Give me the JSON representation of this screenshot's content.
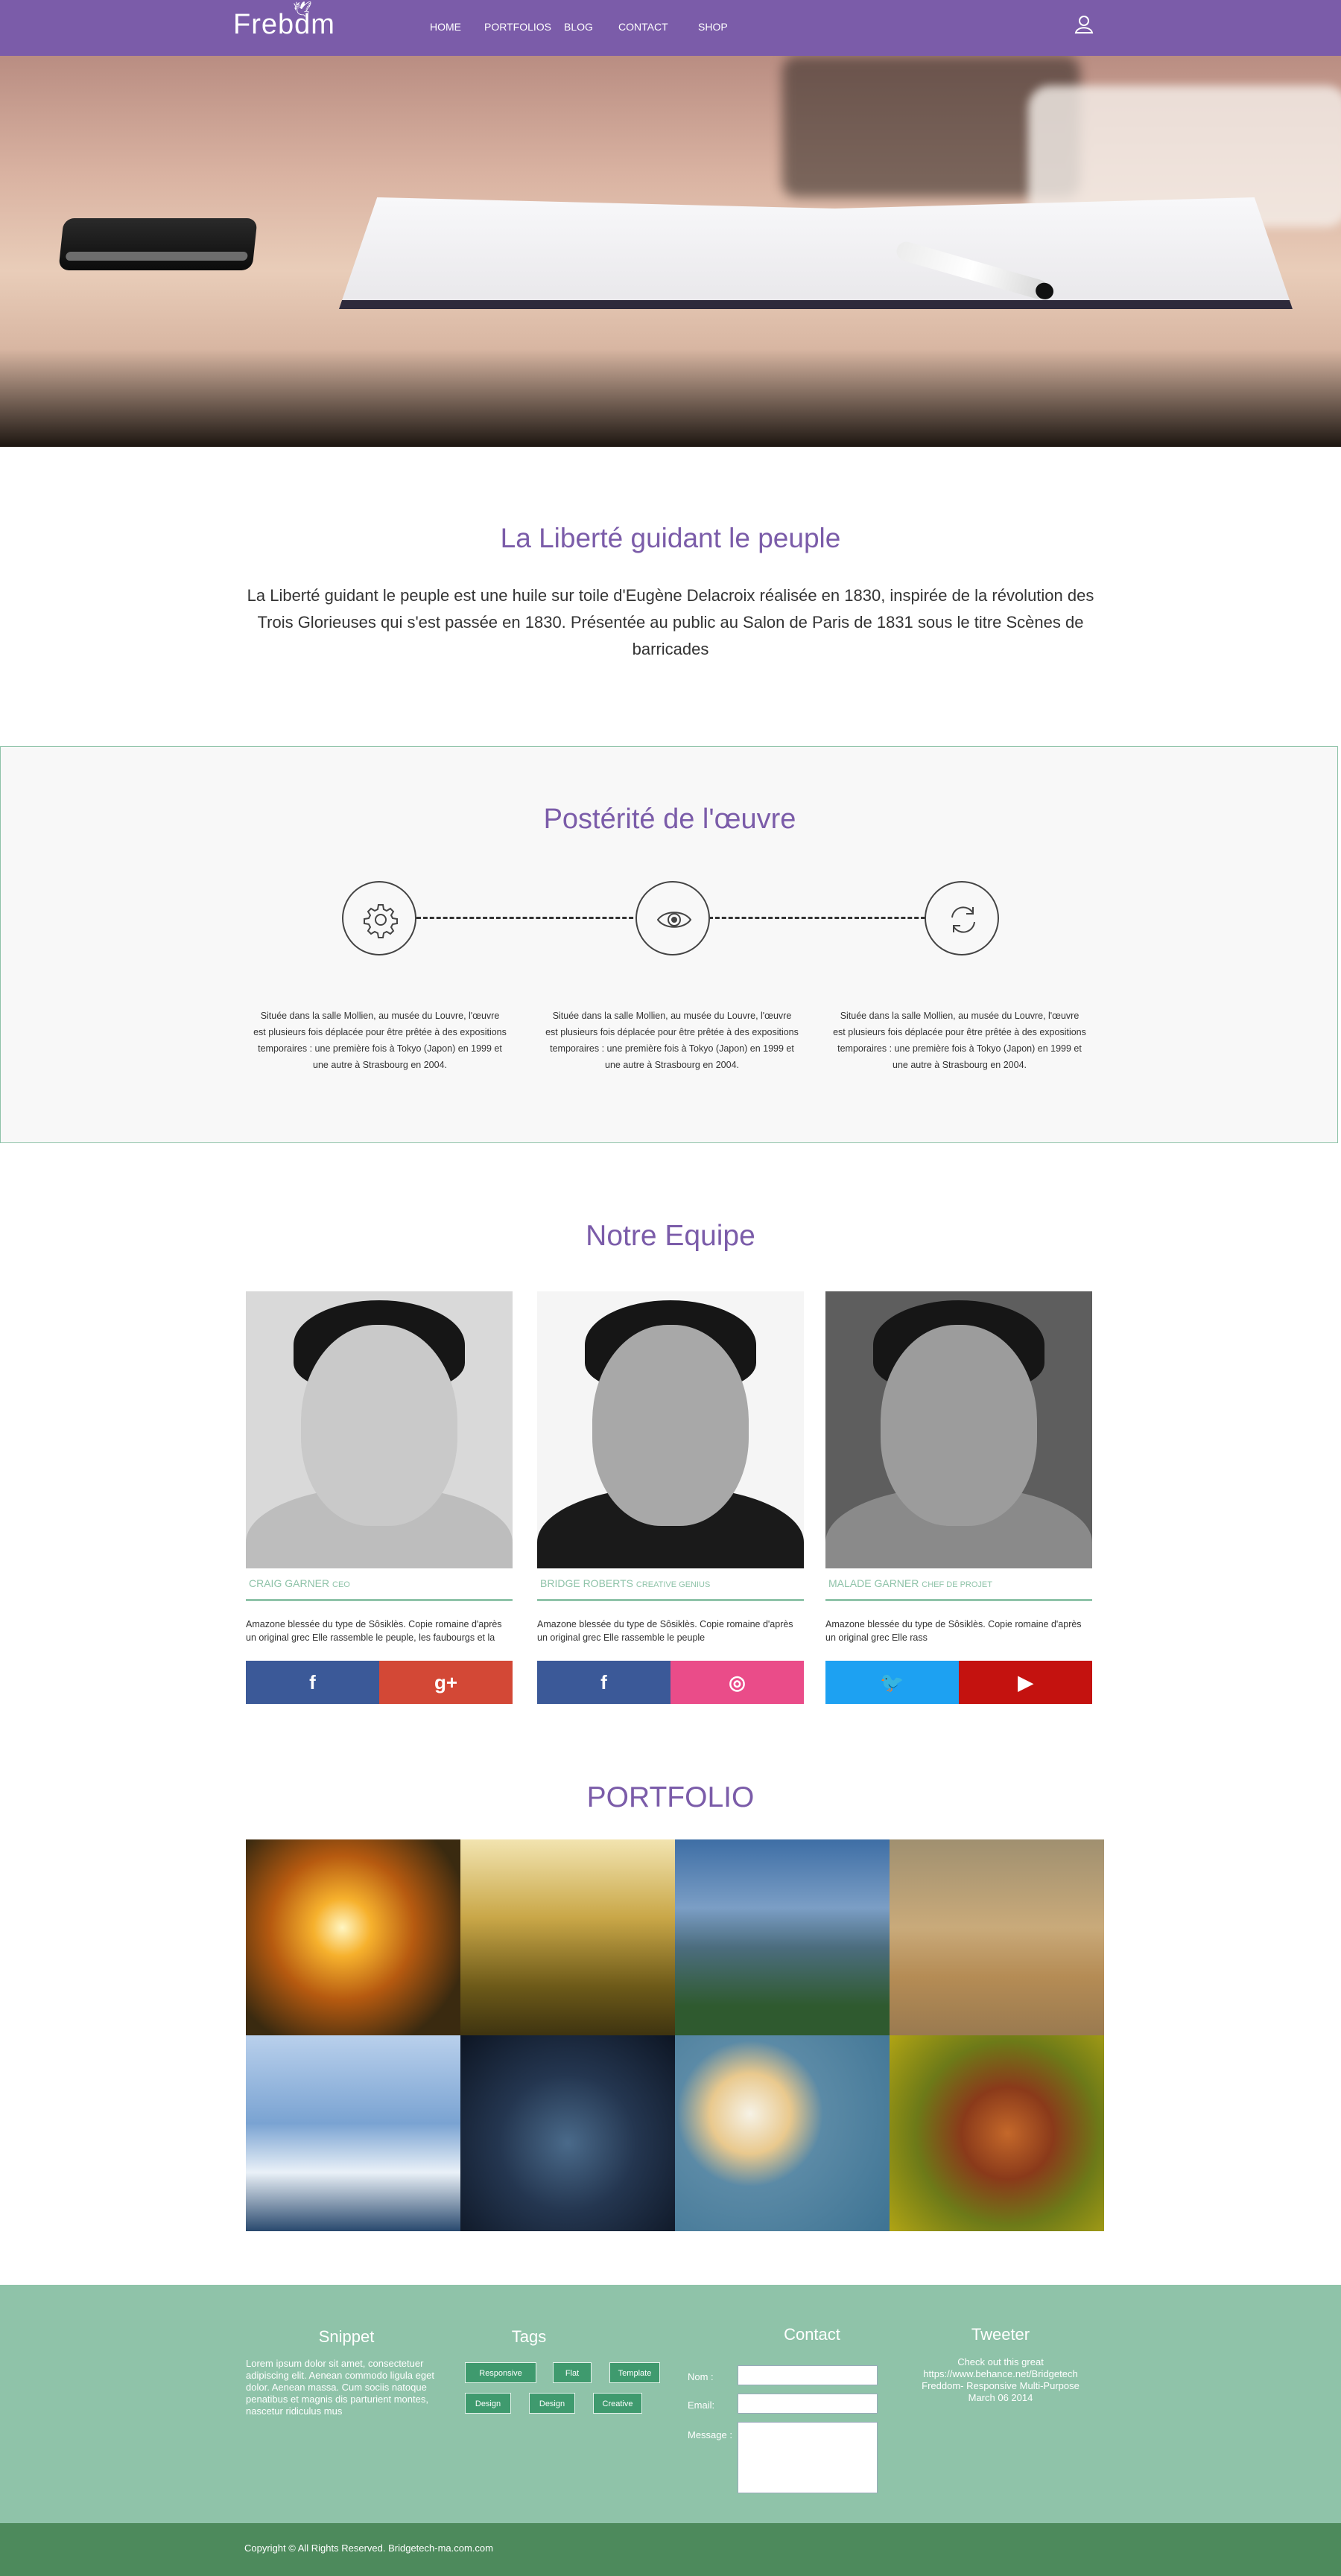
{
  "nav": {
    "logo": "Frebdm",
    "items": [
      "HOME",
      "PORTFOLIOS",
      "BLOG",
      "CONTACT",
      "SHOP"
    ],
    "user_icon": "user-icon"
  },
  "intro": {
    "title": "La Liberté guidant le peuple",
    "text": "La Liberté guidant  le peuple est une huile sur toile d'Eugène Delacroix réalisée en 1830, inspirée de la révolution des Trois Glorieuses qui s'est passée en 1830. Présentée au public au Salon de Paris de 1831 sous le titre Scènes de barricades"
  },
  "posterite": {
    "title": "Postérité de l'œuvre",
    "columns": [
      {
        "icon": "gear-icon",
        "text": "Située dans la salle Mollien, au musée du Louvre, l'œuvre est plusieurs fois déplacée pour être prêtée à des expositions temporaires : une première fois à Tokyo (Japon) en 1999 et une autre à Strasbourg en 2004."
      },
      {
        "icon": "eye-icon",
        "text": "Située dans la salle Mollien, au musée du Louvre, l'œuvre est plusieurs fois déplacée pour être prêtée à des expositions temporaires : une première fois à Tokyo (Japon) en 1999 et une autre à Strasbourg en 2004."
      },
      {
        "icon": "refresh-icon",
        "text": "Située dans la salle Mollien, au musée du Louvre, l'œuvre est plusieurs fois déplacée pour être prêtée à des expositions temporaires : une première fois à Tokyo (Japon) en 1999 et une autre à Strasbourg en 2004."
      }
    ]
  },
  "team": {
    "title": "Notre Equipe",
    "members": [
      {
        "name": "CRAIG GARNER",
        "role": "CEO",
        "desc": "Amazone blessée du type de Sôsiklès. Copie romaine d'après un original grec Elle rassemble le peuple, les faubourgs et la",
        "social": [
          {
            "icon": "facebook-icon",
            "glyph": "f",
            "color": "#3b5998"
          },
          {
            "icon": "google-plus-icon",
            "glyph": "g+",
            "color": "#d34836"
          }
        ]
      },
      {
        "name": "BRIDGE ROBERTS",
        "role": "CREATIVE GENIUS",
        "desc": "Amazone blessée du type de Sôsiklès. Copie romaine d'après un original grec Elle rassemble le peuple",
        "social": [
          {
            "icon": "facebook-icon",
            "glyph": "f",
            "color": "#3b5998"
          },
          {
            "icon": "dribbble-icon",
            "glyph": "◎",
            "color": "#ea4c89"
          }
        ]
      },
      {
        "name": "MALADE GARNER",
        "role": "CHEF DE PROJET",
        "desc": "Amazone blessée du type de Sôsiklès. Copie romaine d'après un original grec Elle rass",
        "social": [
          {
            "icon": "twitter-icon",
            "glyph": "🐦",
            "color": "#1da1f2"
          },
          {
            "icon": "youtube-icon",
            "glyph": "▶",
            "color": "#c4120f"
          }
        ]
      }
    ]
  },
  "portfolio": {
    "title": "PORTFOLIO"
  },
  "footer": {
    "snippet": {
      "title": "Snippet",
      "text": "Lorem ipsum dolor sit amet, consectetuer adipiscing elit. Aenean commodo ligula eget dolor. Aenean massa. Cum sociis natoque penatibus et magnis dis parturient montes, nascetur ridiculus mus"
    },
    "tags": {
      "title": "Tags",
      "items": [
        "Responsive",
        "Flat",
        "Template",
        "Design",
        "Design",
        "Creative"
      ]
    },
    "contact": {
      "title": "Contact",
      "nom": "Nom :",
      "email": "Email:",
      "message": "Message :"
    },
    "tweeter": {
      "title": "Tweeter",
      "text": "Check out this great https://www.behance.net/Bridgetech Freddom- Responsive Multi-Purpose March 06 2014"
    }
  },
  "copyright": "Copyright © All Rights Reserved. Bridgetech-ma.com.com"
}
